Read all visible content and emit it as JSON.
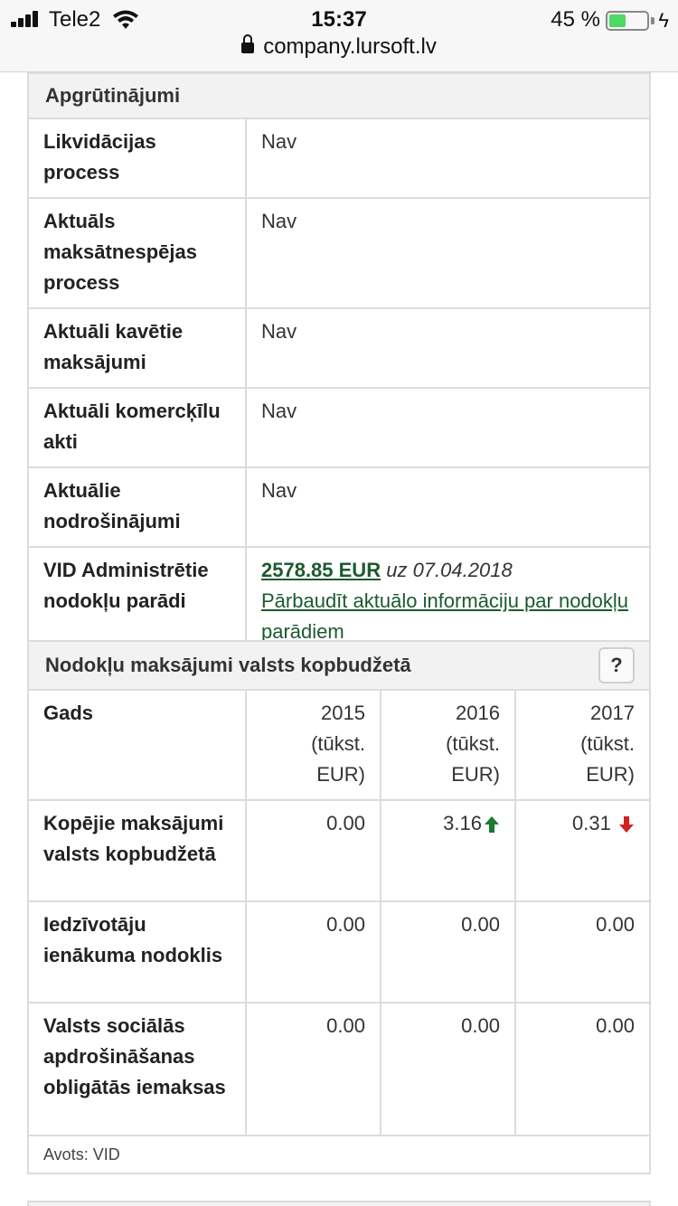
{
  "status_bar": {
    "carrier": "Tele2",
    "time": "15:37",
    "battery_percent": "45 %",
    "battery_level": 0.45,
    "url": "company.lursoft.lv"
  },
  "encumbrances": {
    "title": "Apgrūtinājumi",
    "rows": [
      {
        "label": "Likvidācijas process",
        "value": "Nav"
      },
      {
        "label": "Aktuāls maksātnespējas process",
        "value": "Nav"
      },
      {
        "label": "Aktuāli kavētie maksājumi",
        "value": "Nav"
      },
      {
        "label": "Aktuāli komercķīlu akti",
        "value": "Nav"
      },
      {
        "label": "Aktuālie nodrošinājumi",
        "value": "Nav"
      }
    ],
    "tax_debt": {
      "label": "VID Administrētie nodokļu parādi",
      "amount": "2578.85 EUR",
      "date_note": "uz 07.04.2018",
      "check_link": "Pārbaudīt aktuālo informāciju par nodokļu parādiem"
    }
  },
  "tax_payments": {
    "title": "Nodokļu maksājumi valsts kopbudžetā",
    "help_label": "?",
    "year_header": "Gads",
    "years": [
      "2015 (tūkst. EUR)",
      "2016 (tūkst. EUR)",
      "2017 (tūkst. EUR)"
    ],
    "rows": [
      {
        "label": "Kopējie maksājumi valsts kopbudžetā",
        "values": [
          "0.00",
          "3.16",
          "0.31"
        ],
        "trends": [
          "",
          "up",
          "down"
        ]
      },
      {
        "label": "Iedzīvotāju ienākuma nodoklis",
        "values": [
          "0.00",
          "0.00",
          "0.00"
        ],
        "trends": [
          "",
          "",
          ""
        ]
      },
      {
        "label": "Valsts sociālās apdrošināšanas obligātās iemaksas",
        "values": [
          "0.00",
          "0.00",
          "0.00"
        ],
        "trends": [
          "",
          "",
          ""
        ]
      }
    ],
    "source": "Avots: VID",
    "colors": {
      "up": "#1a7a2e",
      "down": "#d42020",
      "link": "#1c5a2e"
    }
  }
}
